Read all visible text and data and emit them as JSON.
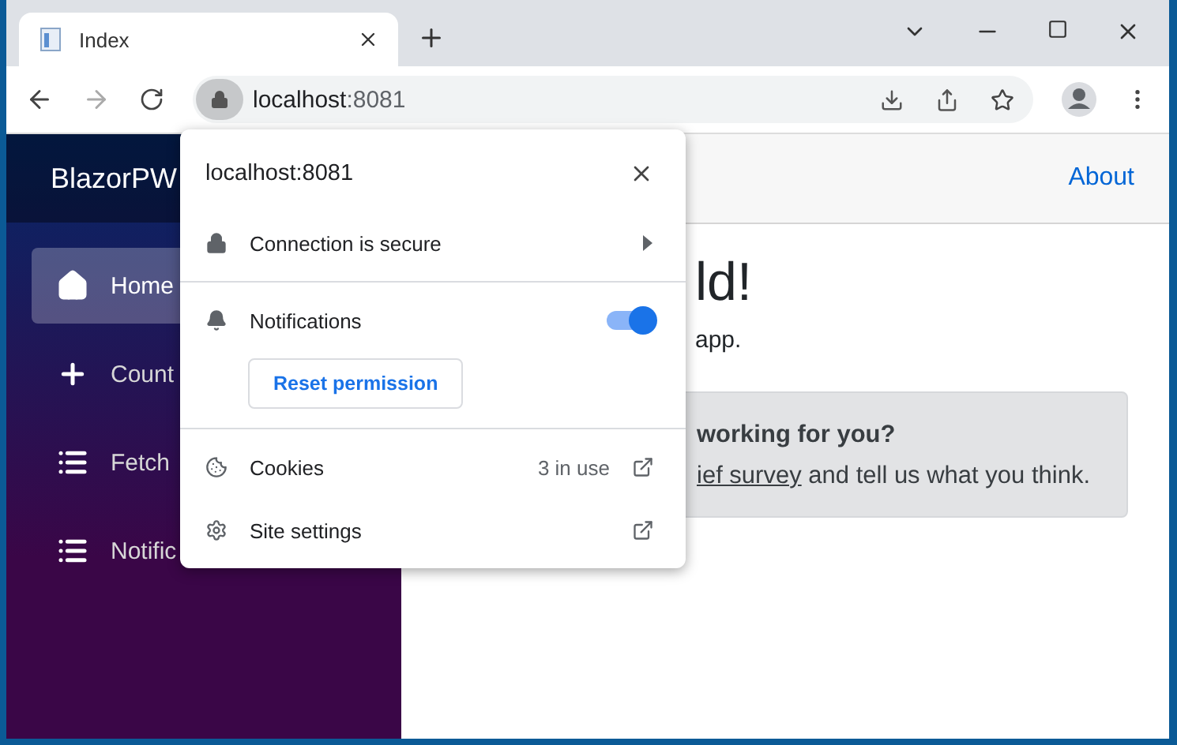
{
  "tab": {
    "title": "Index"
  },
  "address": {
    "host": "localhost",
    "port": ":8081"
  },
  "sidebar": {
    "brand": "BlazorPW",
    "items": [
      {
        "label": "Home",
        "selected": true
      },
      {
        "label": "Count",
        "selected": false
      },
      {
        "label": "Fetch",
        "selected": false
      },
      {
        "label": "Notific",
        "selected": false
      }
    ]
  },
  "top_row": {
    "link": "About"
  },
  "main": {
    "heading": "ld!",
    "intro": "app.",
    "survey": {
      "title": "working for you?",
      "link": "ief survey",
      "rest": " and tell us what you think."
    }
  },
  "popup": {
    "title": "localhost:8081",
    "rows": [
      {
        "kind": "link",
        "label": "Connection is secure"
      },
      {
        "kind": "toggle",
        "label": "Notifications",
        "on": true,
        "button": "Reset permission"
      },
      {
        "kind": "external",
        "label": "Cookies",
        "note": "3 in use"
      },
      {
        "kind": "external",
        "label": "Site settings"
      }
    ]
  }
}
